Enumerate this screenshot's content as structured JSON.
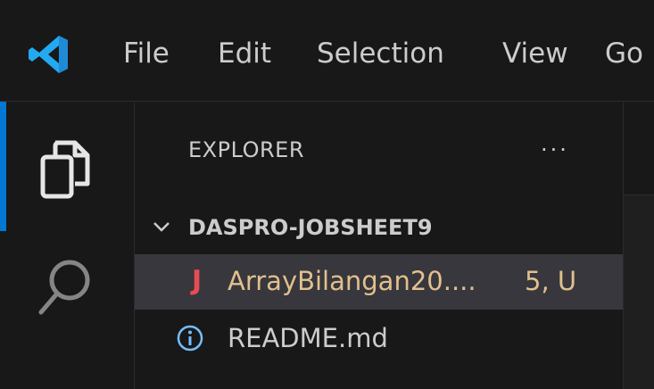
{
  "titlebar": {
    "logo_icon": "vscode-logo-icon",
    "menu": [
      "File",
      "Edit",
      "Selection",
      "View",
      "Go"
    ]
  },
  "activitybar": {
    "items": [
      {
        "icon": "files-icon",
        "active": true
      },
      {
        "icon": "search-icon",
        "active": false
      }
    ]
  },
  "sidebar": {
    "title": "EXPLORER",
    "more_label": "···",
    "section": {
      "title": "DASPRO-JOBSHEET9",
      "expanded": true,
      "files": [
        {
          "icon": "java-icon",
          "icon_glyph": "J",
          "name": "ArrayBilangan20....",
          "badge": "5, U",
          "selected": true,
          "color": "#e2c08d"
        },
        {
          "icon": "info-icon",
          "name": "README.md",
          "badge": "",
          "selected": false,
          "color": "#cccccc"
        }
      ]
    }
  },
  "colors": {
    "accent": "#0078d4",
    "modified": "#e2c08d",
    "java": "#e74c55",
    "background": "#181818"
  }
}
